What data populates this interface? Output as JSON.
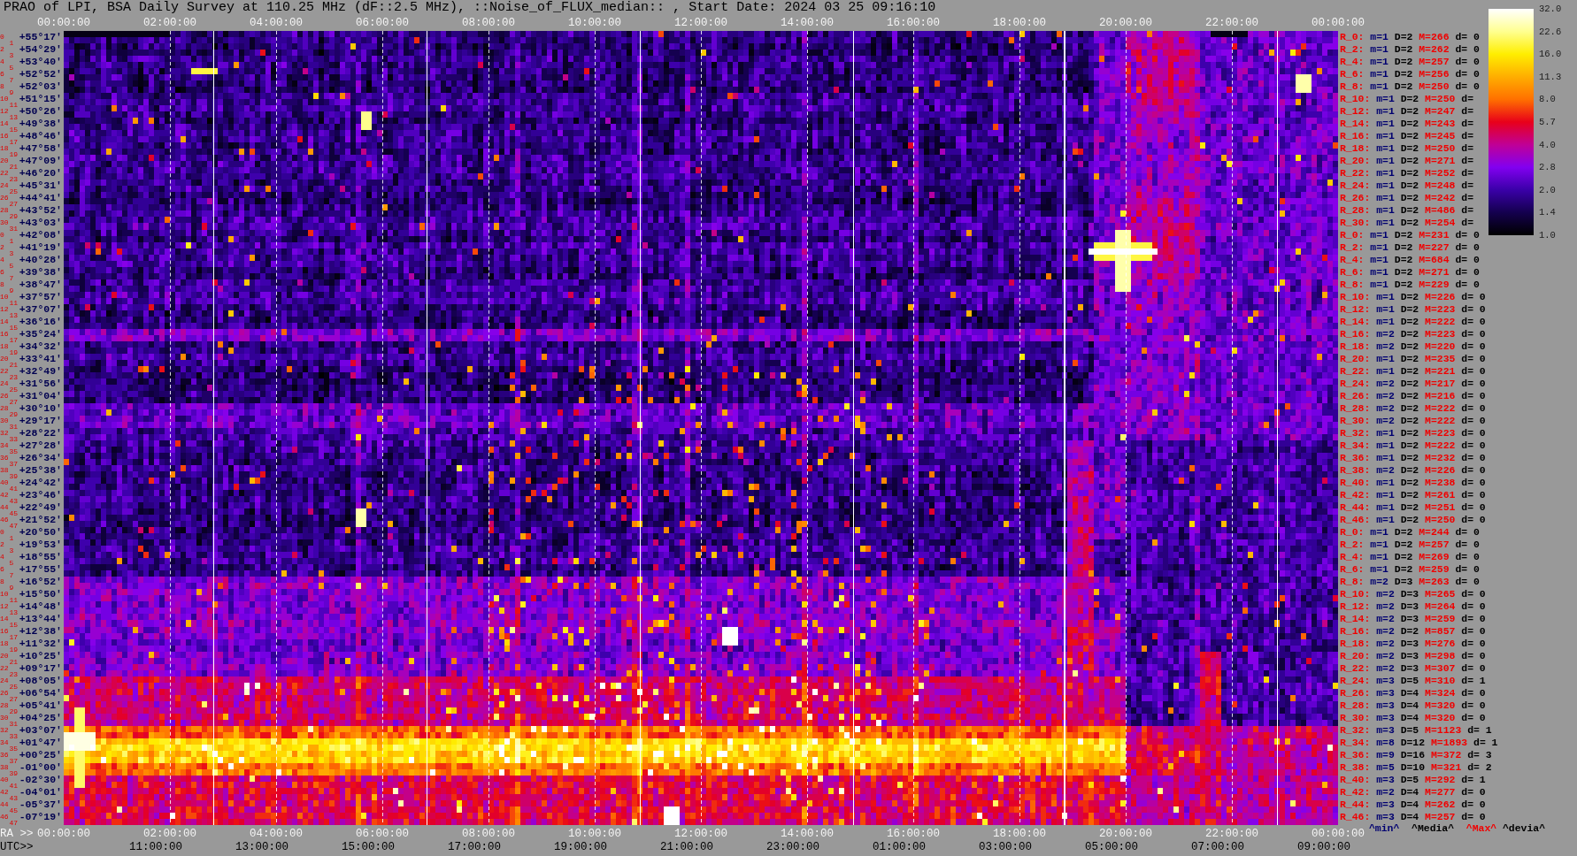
{
  "title": "PRAO of LPI, BSA Daily Survey at 110.25 MHz (dF::2.5 MHz), ::Noise_of_FLUX_median:: , Start Date: 2024 03 25 09:16:10",
  "color_scale": {
    "ticks": [
      "32.0",
      "22.6",
      "16.0",
      "11.3",
      "8.0",
      "5.7",
      "4.0",
      "2.8",
      "2.0",
      "1.4",
      "1.0"
    ]
  },
  "top_axis": {
    "ticks": [
      "00:00:00",
      "02:00:00",
      "04:00:00",
      "06:00:00",
      "08:00:00",
      "10:00:00",
      "12:00:00",
      "14:00:00",
      "16:00:00",
      "18:00:00",
      "20:00:00",
      "22:00:00",
      "00:00:00"
    ]
  },
  "rows": [
    {
      "beams": [
        "0",
        "1"
      ],
      "declination": "+55°17′",
      "stats": {
        "range": "R_0:",
        "min": "m=1",
        "median": "D=2",
        "max": "M=266",
        "deviation": "d= 0"
      }
    },
    {
      "beams": [
        "2",
        "3"
      ],
      "declination": "+54°29′",
      "stats": {
        "range": "R_2:",
        "min": "m=1",
        "median": "D=2",
        "max": "M=262",
        "deviation": "d= 0"
      }
    },
    {
      "beams": [
        "4",
        "5"
      ],
      "declination": "+53°40′",
      "stats": {
        "range": "R_4:",
        "min": "m=1",
        "median": "D=2",
        "max": "M=257",
        "deviation": "d= 0"
      }
    },
    {
      "beams": [
        "6",
        "7"
      ],
      "declination": "+52°52′",
      "stats": {
        "range": "R_6:",
        "min": "m=1",
        "median": "D=2",
        "max": "M=256",
        "deviation": "d= 0"
      }
    },
    {
      "beams": [
        "8",
        "9"
      ],
      "declination": "+52°03′",
      "stats": {
        "range": "R_8:",
        "min": "m=1",
        "median": "D=2",
        "max": "M=250",
        "deviation": "d= 0"
      }
    },
    {
      "beams": [
        "10",
        "11"
      ],
      "declination": "+51°15′",
      "stats": {
        "range": "R_10:",
        "min": "m=1",
        "median": "D=2",
        "max": "M=250",
        "deviation": "d="
      }
    },
    {
      "beams": [
        "12",
        "13"
      ],
      "declination": "+50°26′",
      "stats": {
        "range": "R_12:",
        "min": "m=1",
        "median": "D=2",
        "max": "M=247",
        "deviation": "d="
      }
    },
    {
      "beams": [
        "14",
        "15"
      ],
      "declination": "+49°38′",
      "stats": {
        "range": "R_14:",
        "min": "m=1",
        "median": "D=2",
        "max": "M=243",
        "deviation": "d="
      }
    },
    {
      "beams": [
        "16",
        "17"
      ],
      "declination": "+48°46′",
      "stats": {
        "range": "R_16:",
        "min": "m=1",
        "median": "D=2",
        "max": "M=245",
        "deviation": "d="
      }
    },
    {
      "beams": [
        "18",
        "19"
      ],
      "declination": "+47°58′",
      "stats": {
        "range": "R_18:",
        "min": "m=1",
        "median": "D=2",
        "max": "M=250",
        "deviation": "d="
      }
    },
    {
      "beams": [
        "20",
        "21"
      ],
      "declination": "+47°09′",
      "stats": {
        "range": "R_20:",
        "min": "m=1",
        "median": "D=2",
        "max": "M=271",
        "deviation": "d="
      }
    },
    {
      "beams": [
        "22",
        "23"
      ],
      "declination": "+46°20′",
      "stats": {
        "range": "R_22:",
        "min": "m=1",
        "median": "D=2",
        "max": "M=252",
        "deviation": "d="
      }
    },
    {
      "beams": [
        "24",
        "25"
      ],
      "declination": "+45°31′",
      "stats": {
        "range": "R_24:",
        "min": "m=1",
        "median": "D=2",
        "max": "M=248",
        "deviation": "d="
      }
    },
    {
      "beams": [
        "26",
        "27"
      ],
      "declination": "+44°41′",
      "stats": {
        "range": "R_26:",
        "min": "m=1",
        "median": "D=2",
        "max": "M=242",
        "deviation": "d="
      }
    },
    {
      "beams": [
        "28",
        "29"
      ],
      "declination": "+43°52′",
      "stats": {
        "range": "R_28:",
        "min": "m=1",
        "median": "D=2",
        "max": "M=486",
        "deviation": "d="
      }
    },
    {
      "beams": [
        "30",
        "31"
      ],
      "declination": "+43°03′",
      "stats": {
        "range": "R_30:",
        "min": "m=1",
        "median": "D=2",
        "max": "M=254",
        "deviation": "d="
      }
    },
    {
      "beams": [
        "0",
        "1"
      ],
      "declination": "+42°08′",
      "stats": {
        "range": "R_0:",
        "min": "m=1",
        "median": "D=2",
        "max": "M=231",
        "deviation": "d= 0"
      }
    },
    {
      "beams": [
        "2",
        "3"
      ],
      "declination": "+41°19′",
      "stats": {
        "range": "R_2:",
        "min": "m=1",
        "median": "D=2",
        "max": "M=227",
        "deviation": "d= 0"
      }
    },
    {
      "beams": [
        "4",
        "5"
      ],
      "declination": "+40°28′",
      "stats": {
        "range": "R_4:",
        "min": "m=1",
        "median": "D=2",
        "max": "M=684",
        "deviation": "d= 0"
      }
    },
    {
      "beams": [
        "6",
        "7"
      ],
      "declination": "+39°38′",
      "stats": {
        "range": "R_6:",
        "min": "m=1",
        "median": "D=2",
        "max": "M=271",
        "deviation": "d= 0"
      }
    },
    {
      "beams": [
        "8",
        "9"
      ],
      "declination": "+38°47′",
      "stats": {
        "range": "R_8:",
        "min": "m=1",
        "median": "D=2",
        "max": "M=229",
        "deviation": "d= 0"
      }
    },
    {
      "beams": [
        "10",
        "11"
      ],
      "declination": "+37°57′",
      "stats": {
        "range": "R_10:",
        "min": "m=1",
        "median": "D=2",
        "max": "M=226",
        "deviation": "d= 0"
      }
    },
    {
      "beams": [
        "12",
        "13"
      ],
      "declination": "+37°07′",
      "stats": {
        "range": "R_12:",
        "min": "m=1",
        "median": "D=2",
        "max": "M=223",
        "deviation": "d= 0"
      }
    },
    {
      "beams": [
        "14",
        "15"
      ],
      "declination": "+36°16′",
      "stats": {
        "range": "R_14:",
        "min": "m=1",
        "median": "D=2",
        "max": "M=222",
        "deviation": "d= 0"
      }
    },
    {
      "beams": [
        "16",
        "17"
      ],
      "declination": "+35°24′",
      "stats": {
        "range": "R_16:",
        "min": "m=2",
        "median": "D=2",
        "max": "M=223",
        "deviation": "d= 0"
      }
    },
    {
      "beams": [
        "18",
        "19"
      ],
      "declination": "+34°32′",
      "stats": {
        "range": "R_18:",
        "min": "m=2",
        "median": "D=2",
        "max": "M=220",
        "deviation": "d= 0"
      }
    },
    {
      "beams": [
        "20",
        "21"
      ],
      "declination": "+33°41′",
      "stats": {
        "range": "R_20:",
        "min": "m=1",
        "median": "D=2",
        "max": "M=235",
        "deviation": "d= 0"
      }
    },
    {
      "beams": [
        "22",
        "23"
      ],
      "declination": "+32°49′",
      "stats": {
        "range": "R_22:",
        "min": "m=1",
        "median": "D=2",
        "max": "M=221",
        "deviation": "d= 0"
      }
    },
    {
      "beams": [
        "24",
        "25"
      ],
      "declination": "+31°56′",
      "stats": {
        "range": "R_24:",
        "min": "m=2",
        "median": "D=2",
        "max": "M=217",
        "deviation": "d= 0"
      }
    },
    {
      "beams": [
        "26",
        "27"
      ],
      "declination": "+31°04′",
      "stats": {
        "range": "R_26:",
        "min": "m=2",
        "median": "D=2",
        "max": "M=216",
        "deviation": "d= 0"
      }
    },
    {
      "beams": [
        "28",
        "29"
      ],
      "declination": "+30°10′",
      "stats": {
        "range": "R_28:",
        "min": "m=2",
        "median": "D=2",
        "max": "M=222",
        "deviation": "d= 0"
      }
    },
    {
      "beams": [
        "30",
        "31"
      ],
      "declination": "+29°17′",
      "stats": {
        "range": "R_30:",
        "min": "m=2",
        "median": "D=2",
        "max": "M=222",
        "deviation": "d= 0"
      }
    },
    {
      "beams": [
        "32",
        "33"
      ],
      "declination": "+28°22′",
      "stats": {
        "range": "R_32:",
        "min": "m=1",
        "median": "D=2",
        "max": "M=223",
        "deviation": "d= 0"
      }
    },
    {
      "beams": [
        "34",
        "35"
      ],
      "declination": "+27°28′",
      "stats": {
        "range": "R_34:",
        "min": "m=1",
        "median": "D=2",
        "max": "M=222",
        "deviation": "d= 0"
      }
    },
    {
      "beams": [
        "36",
        "37"
      ],
      "declination": "+26°34′",
      "stats": {
        "range": "R_36:",
        "min": "m=1",
        "median": "D=2",
        "max": "M=232",
        "deviation": "d= 0"
      }
    },
    {
      "beams": [
        "38",
        "39"
      ],
      "declination": "+25°38′",
      "stats": {
        "range": "R_38:",
        "min": "m=2",
        "median": "D=2",
        "max": "M=226",
        "deviation": "d= 0"
      }
    },
    {
      "beams": [
        "40",
        "41"
      ],
      "declination": "+24°42′",
      "stats": {
        "range": "R_40:",
        "min": "m=1",
        "median": "D=2",
        "max": "M=238",
        "deviation": "d= 0"
      }
    },
    {
      "beams": [
        "42",
        "43"
      ],
      "declination": "+23°46′",
      "stats": {
        "range": "R_42:",
        "min": "m=1",
        "median": "D=2",
        "max": "M=261",
        "deviation": "d= 0"
      }
    },
    {
      "beams": [
        "44",
        "45"
      ],
      "declination": "+22°49′",
      "stats": {
        "range": "R_44:",
        "min": "m=1",
        "median": "D=2",
        "max": "M=251",
        "deviation": "d= 0"
      }
    },
    {
      "beams": [
        "46",
        "47"
      ],
      "declination": "+21°52′",
      "stats": {
        "range": "R_46:",
        "min": "m=1",
        "median": "D=2",
        "max": "M=250",
        "deviation": "d= 0"
      }
    },
    {
      "beams": [
        "0",
        "1"
      ],
      "declination": "+20°50′",
      "stats": {
        "range": "R_0:",
        "min": "m=1",
        "median": "D=2",
        "max": "M=244",
        "deviation": "d= 0"
      }
    },
    {
      "beams": [
        "2",
        "3"
      ],
      "declination": "+19°53′",
      "stats": {
        "range": "R_2:",
        "min": "m=1",
        "median": "D=2",
        "max": "M=257",
        "deviation": "d= 0"
      }
    },
    {
      "beams": [
        "4",
        "5"
      ],
      "declination": "+18°55′",
      "stats": {
        "range": "R_4:",
        "min": "m=1",
        "median": "D=2",
        "max": "M=269",
        "deviation": "d= 0"
      }
    },
    {
      "beams": [
        "6",
        "7"
      ],
      "declination": "+17°55′",
      "stats": {
        "range": "R_6:",
        "min": "m=1",
        "median": "D=2",
        "max": "M=259",
        "deviation": "d= 0"
      }
    },
    {
      "beams": [
        "8",
        "9"
      ],
      "declination": "+16°52′",
      "stats": {
        "range": "R_8:",
        "min": "m=2",
        "median": "D=3",
        "max": "M=263",
        "deviation": "d= 0"
      }
    },
    {
      "beams": [
        "10",
        "11"
      ],
      "declination": "+15°50′",
      "stats": {
        "range": "R_10:",
        "min": "m=2",
        "median": "D=3",
        "max": "M=265",
        "deviation": "d= 0"
      }
    },
    {
      "beams": [
        "12",
        "13"
      ],
      "declination": "+14°48′",
      "stats": {
        "range": "R_12:",
        "min": "m=2",
        "median": "D=3",
        "max": "M=264",
        "deviation": "d= 0"
      }
    },
    {
      "beams": [
        "14",
        "15"
      ],
      "declination": "+13°44′",
      "stats": {
        "range": "R_14:",
        "min": "m=2",
        "median": "D=3",
        "max": "M=259",
        "deviation": "d= 0"
      }
    },
    {
      "beams": [
        "16",
        "17"
      ],
      "declination": "+12°38′",
      "stats": {
        "range": "R_16:",
        "min": "m=2",
        "median": "D=2",
        "max": "M=857",
        "deviation": "d= 0"
      }
    },
    {
      "beams": [
        "18",
        "19"
      ],
      "declination": "+11°32′",
      "stats": {
        "range": "R_18:",
        "min": "m=2",
        "median": "D=3",
        "max": "M=276",
        "deviation": "d= 0"
      }
    },
    {
      "beams": [
        "20",
        "21"
      ],
      "declination": "+10°25′",
      "stats": {
        "range": "R_20:",
        "min": "m=2",
        "median": "D=3",
        "max": "M=298",
        "deviation": "d= 0"
      }
    },
    {
      "beams": [
        "22",
        "23"
      ],
      "declination": "+09°17′",
      "stats": {
        "range": "R_22:",
        "min": "m=2",
        "median": "D=3",
        "max": "M=307",
        "deviation": "d= 0"
      }
    },
    {
      "beams": [
        "24",
        "25"
      ],
      "declination": "+08°05′",
      "stats": {
        "range": "R_24:",
        "min": "m=3",
        "median": "D=5",
        "max": "M=310",
        "deviation": "d= 1"
      }
    },
    {
      "beams": [
        "26",
        "27"
      ],
      "declination": "+06°54′",
      "stats": {
        "range": "R_26:",
        "min": "m=3",
        "median": "D=4",
        "max": "M=324",
        "deviation": "d= 0"
      }
    },
    {
      "beams": [
        "28",
        "29"
      ],
      "declination": "+05°41′",
      "stats": {
        "range": "R_28:",
        "min": "m=3",
        "median": "D=4",
        "max": "M=320",
        "deviation": "d= 0"
      }
    },
    {
      "beams": [
        "30",
        "31"
      ],
      "declination": "+04°25′",
      "stats": {
        "range": "R_30:",
        "min": "m=3",
        "median": "D=4",
        "max": "M=320",
        "deviation": "d= 0"
      }
    },
    {
      "beams": [
        "32",
        "33"
      ],
      "declination": "+03°07′",
      "stats": {
        "range": "R_32:",
        "min": "m=3",
        "median": "D=5",
        "max": "M=1123",
        "deviation": "d= 1"
      }
    },
    {
      "beams": [
        "34",
        "35"
      ],
      "declination": "+01°47′",
      "stats": {
        "range": "R_34:",
        "min": "m=8",
        "median": "D=12",
        "max": "M=1893",
        "deviation": "d= 1"
      }
    },
    {
      "beams": [
        "36",
        "37"
      ],
      "declination": "+00°25′",
      "stats": {
        "range": "R_36:",
        "min": "m=9",
        "median": "D=16",
        "max": "M=372",
        "deviation": "d= 3"
      }
    },
    {
      "beams": [
        "38",
        "39"
      ],
      "declination": "-01°00′",
      "stats": {
        "range": "R_38:",
        "min": "m=5",
        "median": "D=10",
        "max": "M=321",
        "deviation": "d= 2"
      }
    },
    {
      "beams": [
        "40",
        "41"
      ],
      "declination": "-02°30′",
      "stats": {
        "range": "R_40:",
        "min": "m=3",
        "median": "D=5",
        "max": "M=292",
        "deviation": "d= 1"
      }
    },
    {
      "beams": [
        "42",
        "43"
      ],
      "declination": "-04°01′",
      "stats": {
        "range": "R_42:",
        "min": "m=2",
        "median": "D=4",
        "max": "M=277",
        "deviation": "d= 0"
      }
    },
    {
      "beams": [
        "44",
        "45"
      ],
      "declination": "-05°37′",
      "stats": {
        "range": "R_44:",
        "min": "m=3",
        "median": "D=4",
        "max": "M=262",
        "deviation": "d= 0"
      }
    },
    {
      "beams": [
        "46",
        "47"
      ],
      "declination": "-07°19′",
      "stats": {
        "range": "R_46:",
        "min": "m=3",
        "median": "D=4",
        "max": "M=257",
        "deviation": "d= 0"
      }
    }
  ],
  "stats_legend": [
    {
      "kind": "min",
      "text": "^min^"
    },
    {
      "kind": "median",
      "text": "^Media^"
    },
    {
      "kind": "max",
      "text": "^Max^"
    },
    {
      "kind": "deviation",
      "text": "^devia^"
    }
  ],
  "bottom_axis": {
    "ra": {
      "label": "RA >>",
      "ticks": [
        "00:00:00",
        "02:00:00",
        "04:00:00",
        "06:00:00",
        "08:00:00",
        "10:00:00",
        "12:00:00",
        "14:00:00",
        "16:00:00",
        "18:00:00",
        "20:00:00",
        "22:00:00",
        "00:00:00"
      ]
    },
    "utc": {
      "label": "UTC>>",
      "ticks": [
        "11:00:00",
        "13:00:00",
        "15:00:00",
        "17:00:00",
        "19:00:00",
        "21:00:00",
        "23:00:00",
        "01:00:00",
        "03:00:00",
        "05:00:00",
        "07:00:00",
        "09:00:00"
      ]
    }
  }
}
